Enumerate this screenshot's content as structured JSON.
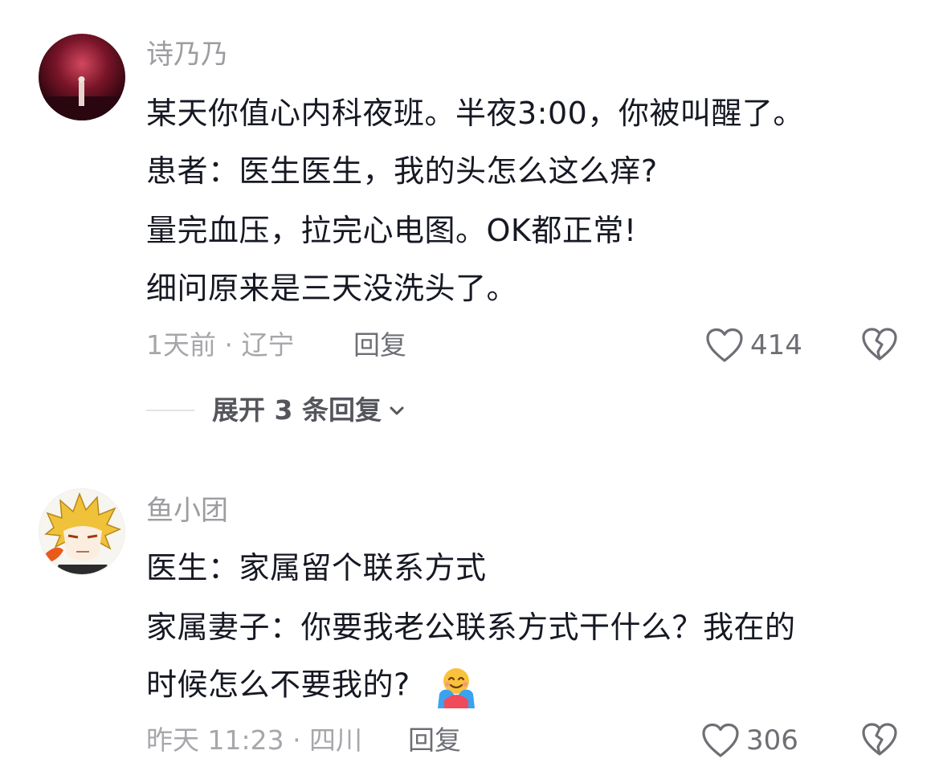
{
  "comments": [
    {
      "username": "诗乃乃",
      "avatar_icon": "dark-red-stage-avatar",
      "lines": [
        "某天你值心内科夜班。半夜3:00，你被叫醒了。",
        "患者：医生医生，我的头怎么这么痒?",
        "量完血压，拉完心电图。OK都正常!",
        "细问原来是三天没洗头了。"
      ],
      "meta": "1天前 · 辽宁",
      "reply_label": "回复",
      "likes": "414",
      "expand_label": "展开 3 条回复"
    },
    {
      "username": "鱼小团",
      "avatar_icon": "anime-character-avatar",
      "lines": [
        "医生：家属留个联系方式",
        "家属妻子：你要我老公联系方式干什么？我在的",
        "时候怎么不要我的?"
      ],
      "emoji": "hugging-face-emoji",
      "meta": "昨天 11:23 · 四川",
      "reply_label": "回复",
      "likes": "306"
    }
  ],
  "colors": {
    "text": "#161823",
    "secondary": "#9c9ca1",
    "icon": "#6e6f75"
  }
}
